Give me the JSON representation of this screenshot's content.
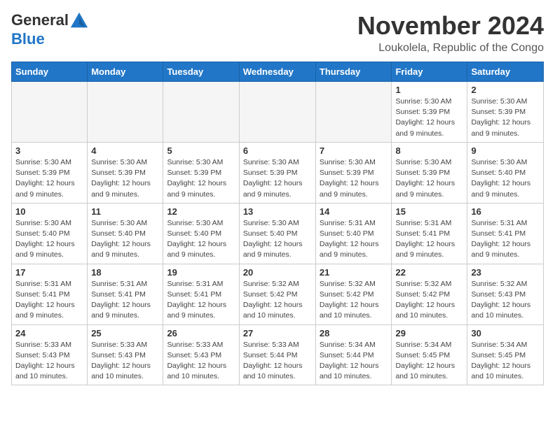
{
  "logo": {
    "general": "General",
    "blue": "Blue"
  },
  "header": {
    "month": "November 2024",
    "location": "Loukolela, Republic of the Congo"
  },
  "weekdays": [
    "Sunday",
    "Monday",
    "Tuesday",
    "Wednesday",
    "Thursday",
    "Friday",
    "Saturday"
  ],
  "weeks": [
    [
      {
        "day": "",
        "info": ""
      },
      {
        "day": "",
        "info": ""
      },
      {
        "day": "",
        "info": ""
      },
      {
        "day": "",
        "info": ""
      },
      {
        "day": "",
        "info": ""
      },
      {
        "day": "1",
        "info": "Sunrise: 5:30 AM\nSunset: 5:39 PM\nDaylight: 12 hours and 9 minutes."
      },
      {
        "day": "2",
        "info": "Sunrise: 5:30 AM\nSunset: 5:39 PM\nDaylight: 12 hours and 9 minutes."
      }
    ],
    [
      {
        "day": "3",
        "info": "Sunrise: 5:30 AM\nSunset: 5:39 PM\nDaylight: 12 hours and 9 minutes."
      },
      {
        "day": "4",
        "info": "Sunrise: 5:30 AM\nSunset: 5:39 PM\nDaylight: 12 hours and 9 minutes."
      },
      {
        "day": "5",
        "info": "Sunrise: 5:30 AM\nSunset: 5:39 PM\nDaylight: 12 hours and 9 minutes."
      },
      {
        "day": "6",
        "info": "Sunrise: 5:30 AM\nSunset: 5:39 PM\nDaylight: 12 hours and 9 minutes."
      },
      {
        "day": "7",
        "info": "Sunrise: 5:30 AM\nSunset: 5:39 PM\nDaylight: 12 hours and 9 minutes."
      },
      {
        "day": "8",
        "info": "Sunrise: 5:30 AM\nSunset: 5:39 PM\nDaylight: 12 hours and 9 minutes."
      },
      {
        "day": "9",
        "info": "Sunrise: 5:30 AM\nSunset: 5:40 PM\nDaylight: 12 hours and 9 minutes."
      }
    ],
    [
      {
        "day": "10",
        "info": "Sunrise: 5:30 AM\nSunset: 5:40 PM\nDaylight: 12 hours and 9 minutes."
      },
      {
        "day": "11",
        "info": "Sunrise: 5:30 AM\nSunset: 5:40 PM\nDaylight: 12 hours and 9 minutes."
      },
      {
        "day": "12",
        "info": "Sunrise: 5:30 AM\nSunset: 5:40 PM\nDaylight: 12 hours and 9 minutes."
      },
      {
        "day": "13",
        "info": "Sunrise: 5:30 AM\nSunset: 5:40 PM\nDaylight: 12 hours and 9 minutes."
      },
      {
        "day": "14",
        "info": "Sunrise: 5:31 AM\nSunset: 5:40 PM\nDaylight: 12 hours and 9 minutes."
      },
      {
        "day": "15",
        "info": "Sunrise: 5:31 AM\nSunset: 5:41 PM\nDaylight: 12 hours and 9 minutes."
      },
      {
        "day": "16",
        "info": "Sunrise: 5:31 AM\nSunset: 5:41 PM\nDaylight: 12 hours and 9 minutes."
      }
    ],
    [
      {
        "day": "17",
        "info": "Sunrise: 5:31 AM\nSunset: 5:41 PM\nDaylight: 12 hours and 9 minutes."
      },
      {
        "day": "18",
        "info": "Sunrise: 5:31 AM\nSunset: 5:41 PM\nDaylight: 12 hours and 9 minutes."
      },
      {
        "day": "19",
        "info": "Sunrise: 5:31 AM\nSunset: 5:41 PM\nDaylight: 12 hours and 9 minutes."
      },
      {
        "day": "20",
        "info": "Sunrise: 5:32 AM\nSunset: 5:42 PM\nDaylight: 12 hours and 10 minutes."
      },
      {
        "day": "21",
        "info": "Sunrise: 5:32 AM\nSunset: 5:42 PM\nDaylight: 12 hours and 10 minutes."
      },
      {
        "day": "22",
        "info": "Sunrise: 5:32 AM\nSunset: 5:42 PM\nDaylight: 12 hours and 10 minutes."
      },
      {
        "day": "23",
        "info": "Sunrise: 5:32 AM\nSunset: 5:43 PM\nDaylight: 12 hours and 10 minutes."
      }
    ],
    [
      {
        "day": "24",
        "info": "Sunrise: 5:33 AM\nSunset: 5:43 PM\nDaylight: 12 hours and 10 minutes."
      },
      {
        "day": "25",
        "info": "Sunrise: 5:33 AM\nSunset: 5:43 PM\nDaylight: 12 hours and 10 minutes."
      },
      {
        "day": "26",
        "info": "Sunrise: 5:33 AM\nSunset: 5:43 PM\nDaylight: 12 hours and 10 minutes."
      },
      {
        "day": "27",
        "info": "Sunrise: 5:33 AM\nSunset: 5:44 PM\nDaylight: 12 hours and 10 minutes."
      },
      {
        "day": "28",
        "info": "Sunrise: 5:34 AM\nSunset: 5:44 PM\nDaylight: 12 hours and 10 minutes."
      },
      {
        "day": "29",
        "info": "Sunrise: 5:34 AM\nSunset: 5:45 PM\nDaylight: 12 hours and 10 minutes."
      },
      {
        "day": "30",
        "info": "Sunrise: 5:34 AM\nSunset: 5:45 PM\nDaylight: 12 hours and 10 minutes."
      }
    ]
  ]
}
